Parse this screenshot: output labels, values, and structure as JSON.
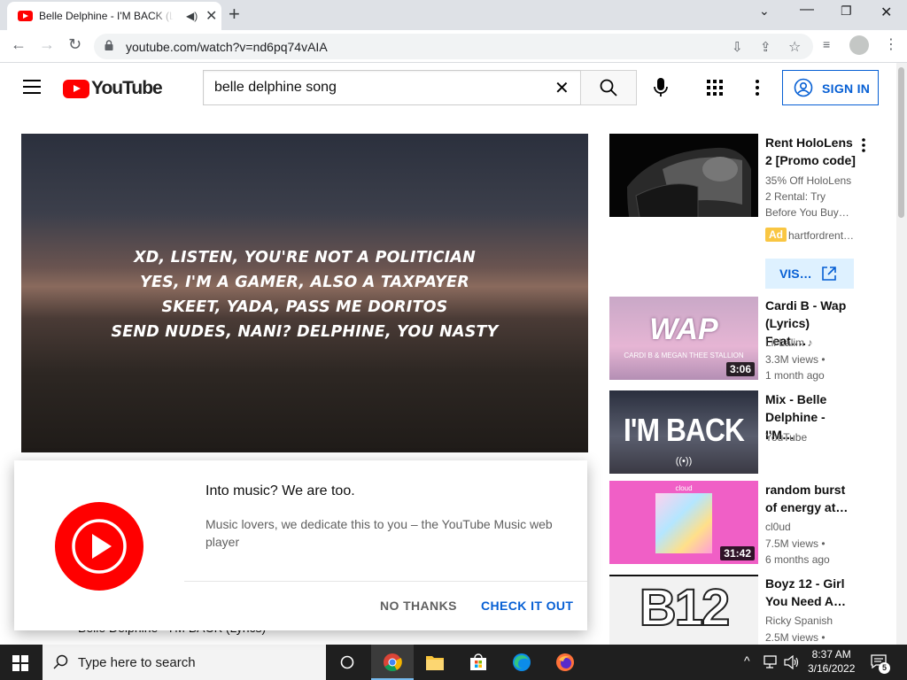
{
  "browser": {
    "tab_title": "Belle Delphine - I'M BACK (Lyrics)",
    "url": "youtube.com/watch?v=nd6pq74vAIA"
  },
  "youtube": {
    "logo_text": "YouTube",
    "search_query": "belle delphine song",
    "signin_label": "SIGN IN"
  },
  "player": {
    "lyrics": [
      "XD, LISTEN, YOU'RE NOT A POLITICIAN",
      "YES, I'M A GAMER, ALSO A TAXPAYER",
      "SKEET, YADA, PASS ME DORITOS",
      "SEND NUDES, NANI? DELPHINE, YOU NASTY"
    ]
  },
  "promo": {
    "title": "Into music? We are too.",
    "body": "Music lovers, we dedicate this to you – the YouTube Music web player",
    "no_thanks": "NO THANKS",
    "check_it_out": "CHECK IT OUT"
  },
  "video_title_partial": "Belle Delphine - I'M BACK (Lyrics)",
  "sidebar": {
    "ad": {
      "title": "Rent HoloLens 2 [Promo code]",
      "desc": "35% Off HoloLens 2 Rental: Try Before You Buy…",
      "badge": "Ad",
      "advertiser": "hartfordrent…",
      "visit": "VIS…"
    },
    "videos": [
      {
        "title": "Cardi B - Wap (Lyrics) Feat.…",
        "channel": "Lil Lalim",
        "views": "3.3M views •",
        "age": "1 month ago",
        "duration": "3:06",
        "thumb_text": "WAP",
        "thumb_sub": "CARDI B & MEGAN THEE STALLION"
      },
      {
        "title": "Mix - Belle Delphine - I'M…",
        "channel": "YouTube",
        "views": "",
        "age": "",
        "duration": "",
        "thumb_text": "I'M BACK",
        "thumb_sub": "((•))"
      },
      {
        "title": "random burst of energy at…",
        "channel": "cl0ud",
        "views": "7.5M views •",
        "age": "6 months ago",
        "duration": "31:42",
        "thumb_text": "cloud",
        "thumb_sub": ""
      },
      {
        "title": "Boyz 12 - Girl You Need A…",
        "channel": "Ricky Spanish",
        "views": "2.5M views •",
        "age": "",
        "duration": "",
        "thumb_text": "B12",
        "thumb_sub": ""
      }
    ]
  },
  "taskbar": {
    "search_placeholder": "Type here to search",
    "time": "8:37 AM",
    "date": "3/16/2022",
    "notifications": "5"
  },
  "colors": {
    "youtube_red": "#ff0000",
    "link_blue": "#065fd4",
    "taskbar": "#1f1f1f"
  }
}
